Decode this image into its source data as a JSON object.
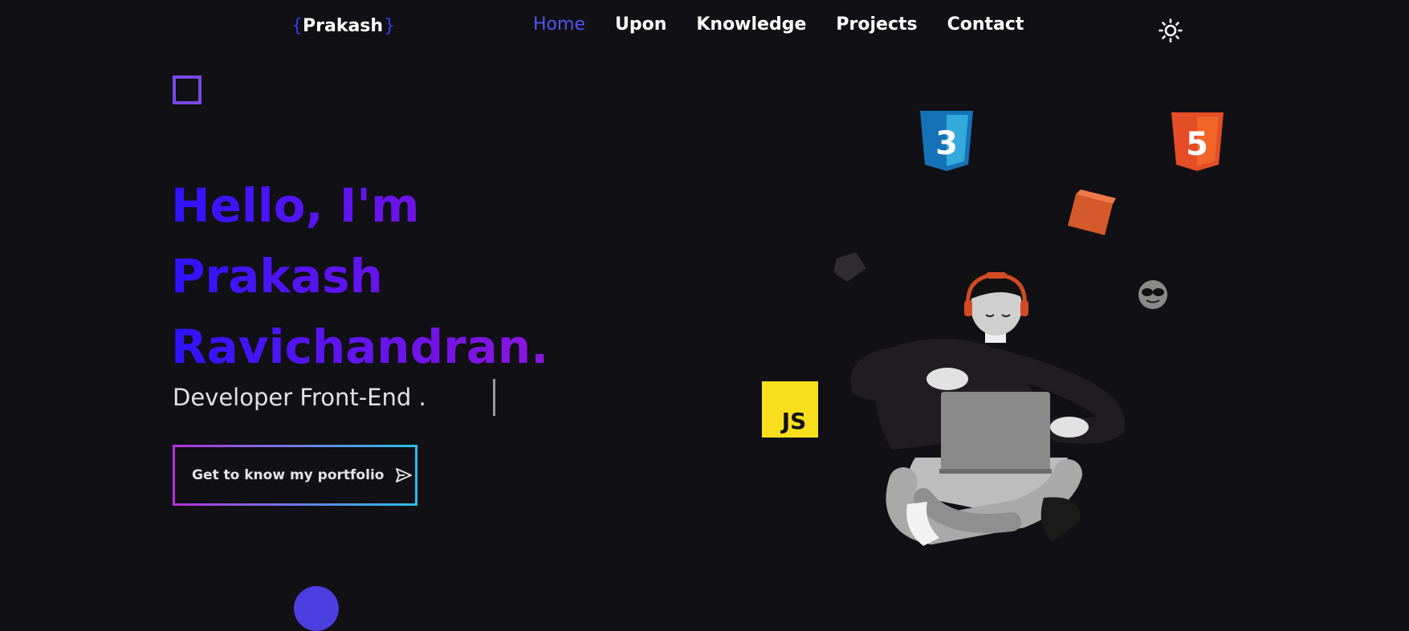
{
  "header": {
    "logo": {
      "open_brace": "{",
      "name": "Prakash",
      "close_brace": "}"
    },
    "nav": [
      {
        "label": "Home",
        "active": true
      },
      {
        "label": "Upon",
        "active": false
      },
      {
        "label": "Knowledge",
        "active": false
      },
      {
        "label": "Projects",
        "active": false
      },
      {
        "label": "Contact",
        "active": false
      }
    ],
    "theme_toggle_icon": "sun-icon"
  },
  "hero": {
    "greeting_line1": "Hello, I'm",
    "greeting_line2": "Prakash",
    "greeting_line3": "Ravichandran",
    "greeting_dot": ".",
    "role": "Developer Front-End .",
    "cta_label": "Get to know my portfolio",
    "cta_icon": "send-icon"
  },
  "illustration": {
    "badges": [
      {
        "icon": "css3-icon",
        "label": "3"
      },
      {
        "icon": "html5-icon",
        "label": "5"
      },
      {
        "icon": "javascript-icon",
        "label": "JS"
      }
    ]
  },
  "colors": {
    "background": "#111015",
    "accent_blue": "#2d13ff",
    "accent_purple": "#8c15dc",
    "nav_active": "#4f55f0",
    "css_badge": "#1572b6",
    "html_badge": "#e44d26",
    "js_badge": "#f7df1e"
  }
}
